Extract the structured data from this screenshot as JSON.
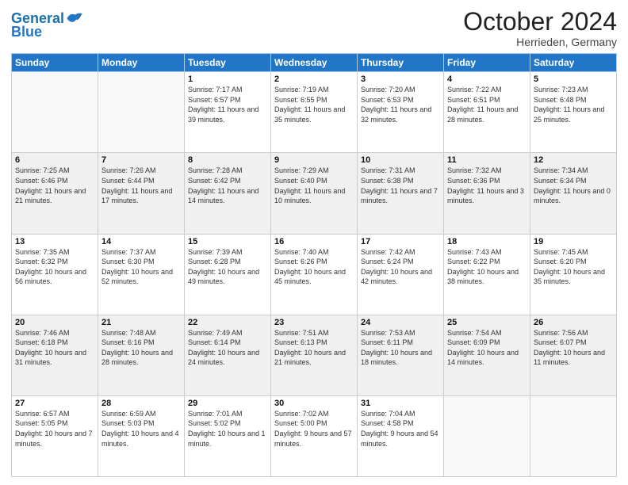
{
  "header": {
    "logo_line1": "General",
    "logo_line2": "Blue",
    "month": "October 2024",
    "location": "Herrieden, Germany"
  },
  "weekdays": [
    "Sunday",
    "Monday",
    "Tuesday",
    "Wednesday",
    "Thursday",
    "Friday",
    "Saturday"
  ],
  "weeks": [
    [
      {
        "day": "",
        "info": ""
      },
      {
        "day": "",
        "info": ""
      },
      {
        "day": "1",
        "info": "Sunrise: 7:17 AM\nSunset: 6:57 PM\nDaylight: 11 hours and 39 minutes."
      },
      {
        "day": "2",
        "info": "Sunrise: 7:19 AM\nSunset: 6:55 PM\nDaylight: 11 hours and 35 minutes."
      },
      {
        "day": "3",
        "info": "Sunrise: 7:20 AM\nSunset: 6:53 PM\nDaylight: 11 hours and 32 minutes."
      },
      {
        "day": "4",
        "info": "Sunrise: 7:22 AM\nSunset: 6:51 PM\nDaylight: 11 hours and 28 minutes."
      },
      {
        "day": "5",
        "info": "Sunrise: 7:23 AM\nSunset: 6:48 PM\nDaylight: 11 hours and 25 minutes."
      }
    ],
    [
      {
        "day": "6",
        "info": "Sunrise: 7:25 AM\nSunset: 6:46 PM\nDaylight: 11 hours and 21 minutes."
      },
      {
        "day": "7",
        "info": "Sunrise: 7:26 AM\nSunset: 6:44 PM\nDaylight: 11 hours and 17 minutes."
      },
      {
        "day": "8",
        "info": "Sunrise: 7:28 AM\nSunset: 6:42 PM\nDaylight: 11 hours and 14 minutes."
      },
      {
        "day": "9",
        "info": "Sunrise: 7:29 AM\nSunset: 6:40 PM\nDaylight: 11 hours and 10 minutes."
      },
      {
        "day": "10",
        "info": "Sunrise: 7:31 AM\nSunset: 6:38 PM\nDaylight: 11 hours and 7 minutes."
      },
      {
        "day": "11",
        "info": "Sunrise: 7:32 AM\nSunset: 6:36 PM\nDaylight: 11 hours and 3 minutes."
      },
      {
        "day": "12",
        "info": "Sunrise: 7:34 AM\nSunset: 6:34 PM\nDaylight: 11 hours and 0 minutes."
      }
    ],
    [
      {
        "day": "13",
        "info": "Sunrise: 7:35 AM\nSunset: 6:32 PM\nDaylight: 10 hours and 56 minutes."
      },
      {
        "day": "14",
        "info": "Sunrise: 7:37 AM\nSunset: 6:30 PM\nDaylight: 10 hours and 52 minutes."
      },
      {
        "day": "15",
        "info": "Sunrise: 7:39 AM\nSunset: 6:28 PM\nDaylight: 10 hours and 49 minutes."
      },
      {
        "day": "16",
        "info": "Sunrise: 7:40 AM\nSunset: 6:26 PM\nDaylight: 10 hours and 45 minutes."
      },
      {
        "day": "17",
        "info": "Sunrise: 7:42 AM\nSunset: 6:24 PM\nDaylight: 10 hours and 42 minutes."
      },
      {
        "day": "18",
        "info": "Sunrise: 7:43 AM\nSunset: 6:22 PM\nDaylight: 10 hours and 38 minutes."
      },
      {
        "day": "19",
        "info": "Sunrise: 7:45 AM\nSunset: 6:20 PM\nDaylight: 10 hours and 35 minutes."
      }
    ],
    [
      {
        "day": "20",
        "info": "Sunrise: 7:46 AM\nSunset: 6:18 PM\nDaylight: 10 hours and 31 minutes."
      },
      {
        "day": "21",
        "info": "Sunrise: 7:48 AM\nSunset: 6:16 PM\nDaylight: 10 hours and 28 minutes."
      },
      {
        "day": "22",
        "info": "Sunrise: 7:49 AM\nSunset: 6:14 PM\nDaylight: 10 hours and 24 minutes."
      },
      {
        "day": "23",
        "info": "Sunrise: 7:51 AM\nSunset: 6:13 PM\nDaylight: 10 hours and 21 minutes."
      },
      {
        "day": "24",
        "info": "Sunrise: 7:53 AM\nSunset: 6:11 PM\nDaylight: 10 hours and 18 minutes."
      },
      {
        "day": "25",
        "info": "Sunrise: 7:54 AM\nSunset: 6:09 PM\nDaylight: 10 hours and 14 minutes."
      },
      {
        "day": "26",
        "info": "Sunrise: 7:56 AM\nSunset: 6:07 PM\nDaylight: 10 hours and 11 minutes."
      }
    ],
    [
      {
        "day": "27",
        "info": "Sunrise: 6:57 AM\nSunset: 5:05 PM\nDaylight: 10 hours and 7 minutes."
      },
      {
        "day": "28",
        "info": "Sunrise: 6:59 AM\nSunset: 5:03 PM\nDaylight: 10 hours and 4 minutes."
      },
      {
        "day": "29",
        "info": "Sunrise: 7:01 AM\nSunset: 5:02 PM\nDaylight: 10 hours and 1 minute."
      },
      {
        "day": "30",
        "info": "Sunrise: 7:02 AM\nSunset: 5:00 PM\nDaylight: 9 hours and 57 minutes."
      },
      {
        "day": "31",
        "info": "Sunrise: 7:04 AM\nSunset: 4:58 PM\nDaylight: 9 hours and 54 minutes."
      },
      {
        "day": "",
        "info": ""
      },
      {
        "day": "",
        "info": ""
      }
    ]
  ]
}
